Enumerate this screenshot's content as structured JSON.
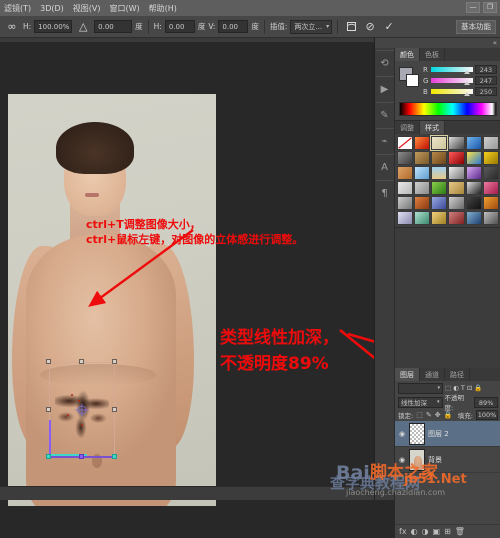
{
  "app": {
    "title": "Adobe Photoshop",
    "menu": [
      {
        "label": "滤镜(T)"
      },
      {
        "label": "3D(D)"
      },
      {
        "label": "视图(V)"
      },
      {
        "label": "窗口(W)"
      },
      {
        "label": "帮助(H)"
      }
    ],
    "window_controls": [
      {
        "name": "minimize-button",
        "glyph": "—"
      },
      {
        "name": "restore-button",
        "glyph": "❐"
      }
    ]
  },
  "options_bar": {
    "link_icon": "∞",
    "width_label": "H:",
    "width_value": "100.00%",
    "skew_icon": "△",
    "angle_value": "0.00",
    "degree_unit_1": "度",
    "h_skew_label": "H:",
    "h_skew_value": "0.00",
    "degree_unit_2": "度",
    "v_skew_label": "V:",
    "v_skew_value": "0.00",
    "degree_unit_3": "度",
    "interp_label": "插值:",
    "interp_value": "两次立...",
    "warp_icon": "warp-icon",
    "cancel_icon": "⊘",
    "commit_icon": "✓",
    "workspace_label": "基本功能"
  },
  "canvas": {
    "annotation_top_line1": "ctrl+T调整图像大小，",
    "annotation_top_line2": "ctrl+鼠标左键，对图像的立体感进行调整。",
    "annotation_right_line1": "类型线性加深，",
    "annotation_right_line2": "不透明度89%",
    "annotation_color": "#ee0b0b"
  },
  "dock": {
    "collapse_icon": "«",
    "rail_items": [
      {
        "name": "rail-item-history",
        "glyph": "⟲"
      },
      {
        "name": "rail-item-actions",
        "glyph": "▶"
      },
      {
        "name": "rail-item-brush",
        "glyph": "✎"
      },
      {
        "name": "rail-item-clone-source",
        "glyph": "⌁"
      },
      {
        "name": "rail-item-character",
        "glyph": "A"
      },
      {
        "name": "rail-item-paragraph",
        "glyph": "¶"
      }
    ]
  },
  "color_panel": {
    "tabs": [
      {
        "label": "颜色",
        "active": true
      },
      {
        "label": "色板",
        "active": false
      }
    ],
    "foreground_color": "#a9a9b4",
    "background_color": "#ffffff",
    "channels": [
      {
        "label": "R",
        "value": "243"
      },
      {
        "label": "G",
        "value": "247"
      },
      {
        "label": "B",
        "value": "250"
      }
    ]
  },
  "styles_panel": {
    "tabs": [
      {
        "label": "调整",
        "active": false
      },
      {
        "label": "样式",
        "active": true
      }
    ],
    "swatch_count": 36,
    "selected_index": 2
  },
  "layers_panel": {
    "tabs": [
      {
        "label": "图层",
        "active": true
      },
      {
        "label": "通道",
        "active": false
      },
      {
        "label": "路径",
        "active": false
      }
    ],
    "filter_icons": [
      "⬚",
      "◐",
      "T",
      "⊡",
      "🔒"
    ],
    "blend_mode": "线性加深",
    "opacity_label": "不透明度:",
    "opacity_value": "89%",
    "lock_label": "锁定:",
    "lock_icons": [
      "⬚",
      "✎",
      "✥",
      "🔒"
    ],
    "fill_label": "填充:",
    "fill_value": "100%",
    "layers": [
      {
        "name": "图层 2",
        "visible": true,
        "selected": true,
        "thumb": "checker"
      },
      {
        "name": "背景",
        "visible": true,
        "selected": false,
        "thumb": "photo"
      }
    ],
    "bottom_icons": [
      "fx",
      "◐",
      "◑",
      "▣",
      "⊞",
      "🗑"
    ]
  },
  "watermarks": {
    "baidu": "Bai",
    "jb51_cn": "脚本之家",
    "jb51_en": "jb51.Net",
    "chazidian_cn": "查字典教程网",
    "chazidian_url": "jiaocheng.chazidian.com"
  }
}
